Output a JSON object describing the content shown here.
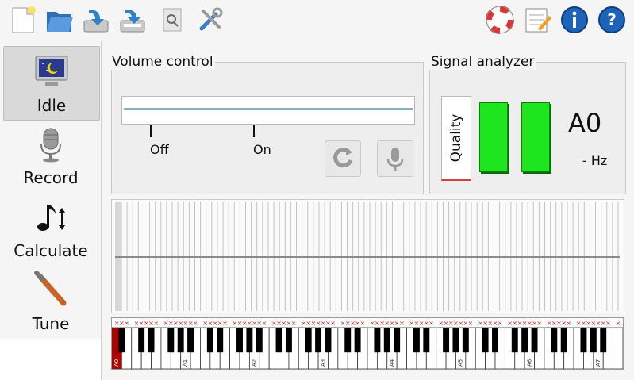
{
  "toolbar": {
    "left": [
      {
        "name": "new-document-icon"
      },
      {
        "name": "open-folder-icon"
      },
      {
        "name": "save-icon"
      },
      {
        "name": "save-as-icon"
      },
      {
        "name": "print-preview-icon"
      },
      {
        "name": "tools-icon"
      }
    ],
    "right": [
      {
        "name": "help-lifebuoy-icon"
      },
      {
        "name": "notes-icon"
      },
      {
        "name": "info-icon"
      },
      {
        "name": "question-icon"
      }
    ]
  },
  "modes": [
    {
      "label": "Idle",
      "icon": "monitor-moon-icon",
      "active": true
    },
    {
      "label": "Record",
      "icon": "microphone-icon",
      "active": false
    },
    {
      "label": "Calculate",
      "icon": "music-note-icon",
      "active": false
    },
    {
      "label": "Tune",
      "icon": "tuning-hammer-icon",
      "active": false
    }
  ],
  "volume": {
    "title": "Volume control",
    "off_label": "Off",
    "on_label": "On"
  },
  "signal": {
    "title": "Signal analyzer",
    "quality_label": "Quality",
    "note": "A0",
    "freq": "- Hz"
  },
  "piano": {
    "octave_labels": [
      "A0",
      "A1",
      "A2",
      "A3",
      "A4",
      "A5",
      "A6",
      "A7"
    ],
    "key_count": 88,
    "marker_char": "×"
  },
  "colors": {
    "accent_green": "#1ee61e",
    "marker_red": "#cc2222",
    "active_key": "#b00000"
  }
}
